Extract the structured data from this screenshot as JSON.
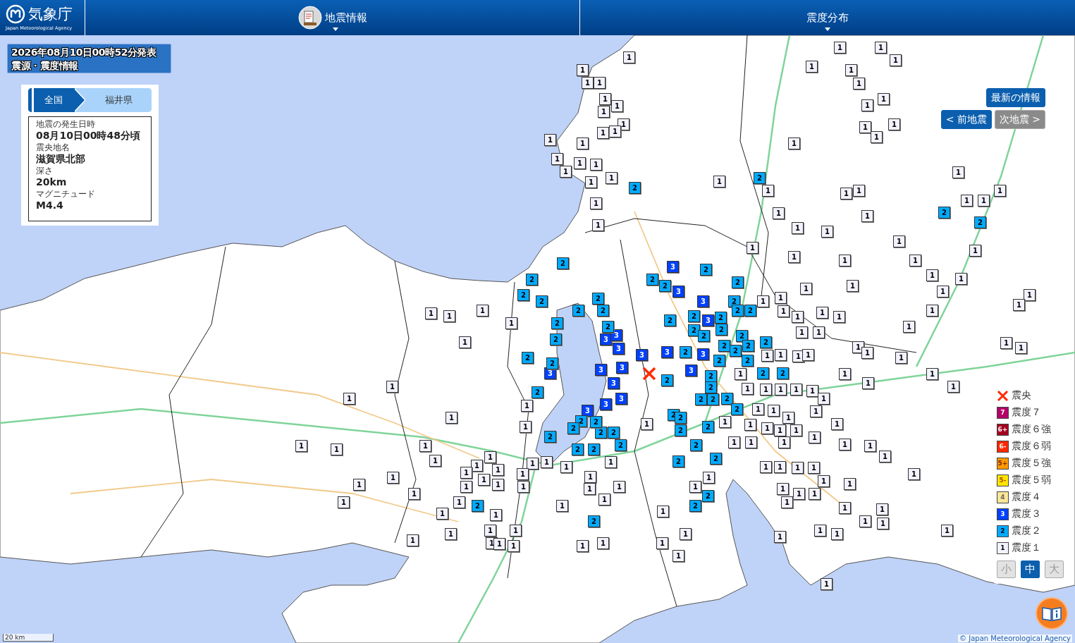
{
  "header": {
    "logo_title": "気象庁",
    "logo_subtitle": "Japan Meteorological Agency",
    "menus": [
      {
        "label": "地震情報",
        "has_icon": true
      },
      {
        "label": "震度分布",
        "has_icon": false
      }
    ]
  },
  "title_box": {
    "line_1": "2026年08月10日00時52分発表",
    "line_2": "震源・震度情報"
  },
  "info_panel": {
    "tabs": [
      {
        "label": "全国",
        "selected": true
      },
      {
        "label": "福井県",
        "selected": false
      }
    ],
    "fields": [
      {
        "label": "地震の発生日時",
        "value": "08月10日00時48分頃"
      },
      {
        "label": "震央地名",
        "value": "滋賀県北部"
      },
      {
        "label": "深さ",
        "value": "20km"
      },
      {
        "label": "マグニチュード",
        "value": "M4.4"
      }
    ]
  },
  "latest_button": "最新の情報",
  "nav_buttons": [
    {
      "label": "< 前地震",
      "disabled": false
    },
    {
      "label": "次地震 >",
      "disabled": true
    }
  ],
  "legend": {
    "items": [
      {
        "kind": "epicenter",
        "text": "震央"
      },
      {
        "kind": "s7",
        "badge": "7",
        "text": "震度７"
      },
      {
        "kind": "s6p",
        "badge": "6+",
        "text": "震度６強"
      },
      {
        "kind": "s6m",
        "badge": "6-",
        "text": "震度６弱"
      },
      {
        "kind": "s5p",
        "badge": "5+",
        "text": "震度５強"
      },
      {
        "kind": "s5m",
        "badge": "5-",
        "text": "震度５弱"
      },
      {
        "kind": "s4",
        "badge": "4",
        "text": "震度４"
      },
      {
        "kind": "s3",
        "badge": "3",
        "text": "震度３"
      },
      {
        "kind": "s2",
        "badge": "2",
        "text": "震度２"
      },
      {
        "kind": "s1",
        "badge": "1",
        "text": "震度１"
      }
    ],
    "sizes": [
      {
        "label": "小",
        "selected": false
      },
      {
        "label": "中",
        "selected": true
      },
      {
        "label": "大",
        "selected": false
      }
    ]
  },
  "scale_label": "20 km",
  "copyright": "© Japan Meteorological Agency",
  "markers": [
    {
      "kind": "s3",
      "label": "3"
    },
    {
      "kind": "s3",
      "label": "3"
    },
    {
      "kind": "s3",
      "label": "3"
    },
    {
      "kind": "s3",
      "label": "3"
    },
    {
      "kind": "s3",
      "label": "3"
    },
    {
      "kind": "s3",
      "label": "3"
    },
    {
      "kind": "s3",
      "label": "3"
    },
    {
      "kind": "s3",
      "label": "3"
    },
    {
      "kind": "s3",
      "label": "3"
    },
    {
      "kind": "s3",
      "label": "3"
    },
    {
      "kind": "s3",
      "label": "3"
    },
    {
      "kind": "s3",
      "label": "3"
    },
    {
      "kind": "s3",
      "label": "3"
    },
    {
      "kind": "s3",
      "label": "3"
    },
    {
      "kind": "s3",
      "label": "3"
    },
    {
      "kind": "s3",
      "label": "3"
    },
    {
      "kind": "s3",
      "label": "3"
    },
    {
      "kind": "s3",
      "label": "3"
    },
    {
      "kind": "s2",
      "label": "2"
    },
    {
      "kind": "s2",
      "label": "2"
    },
    {
      "kind": "s2",
      "label": "2"
    },
    {
      "kind": "s2",
      "label": "2"
    },
    {
      "kind": "s2",
      "label": "2"
    },
    {
      "kind": "s2",
      "label": "2"
    },
    {
      "kind": "s2",
      "label": "2"
    },
    {
      "kind": "s2",
      "label": "2"
    },
    {
      "kind": "s2",
      "label": "2"
    },
    {
      "kind": "s2",
      "label": "2"
    },
    {
      "kind": "s2",
      "label": "2"
    },
    {
      "kind": "s2",
      "label": "2"
    },
    {
      "kind": "s2",
      "label": "2"
    },
    {
      "kind": "s2",
      "label": "2"
    },
    {
      "kind": "s2",
      "label": "2"
    },
    {
      "kind": "s2",
      "label": "2"
    },
    {
      "kind": "s2",
      "label": "2"
    },
    {
      "kind": "s2",
      "label": "2"
    },
    {
      "kind": "s2",
      "label": "2"
    },
    {
      "kind": "s2",
      "label": "2"
    },
    {
      "kind": "s2",
      "label": "2"
    },
    {
      "kind": "s2",
      "label": "2"
    },
    {
      "kind": "s2",
      "label": "2"
    },
    {
      "kind": "s2",
      "label": "2"
    },
    {
      "kind": "s2",
      "label": "2"
    },
    {
      "kind": "s2",
      "label": "2"
    },
    {
      "kind": "s2",
      "label": "2"
    },
    {
      "kind": "s2",
      "label": "2"
    },
    {
      "kind": "s2",
      "label": "2"
    },
    {
      "kind": "s2",
      "label": "2"
    },
    {
      "kind": "s2",
      "label": "2"
    },
    {
      "kind": "s2",
      "label": "2"
    },
    {
      "kind": "s2",
      "label": "2"
    },
    {
      "kind": "s2",
      "label": "2"
    },
    {
      "kind": "s2",
      "label": "2"
    },
    {
      "kind": "s2",
      "label": "2"
    },
    {
      "kind": "s2",
      "label": "2"
    },
    {
      "kind": "s2",
      "label": "2"
    },
    {
      "kind": "s2",
      "label": "2"
    },
    {
      "kind": "s2",
      "label": "2"
    },
    {
      "kind": "s2",
      "label": "2"
    },
    {
      "kind": "s2",
      "label": "2"
    },
    {
      "kind": "s2",
      "label": "2"
    },
    {
      "kind": "s2",
      "label": "2"
    },
    {
      "kind": "s2",
      "label": "2"
    },
    {
      "kind": "s2",
      "label": "2"
    },
    {
      "kind": "s2",
      "label": "2"
    },
    {
      "kind": "s2",
      "label": "2"
    },
    {
      "kind": "s2",
      "label": "2"
    },
    {
      "kind": "s2",
      "label": "2"
    },
    {
      "kind": "s2",
      "label": "2"
    },
    {
      "kind": "s2",
      "label": "2"
    },
    {
      "kind": "s2",
      "label": "2"
    },
    {
      "kind": "s2",
      "label": "2"
    },
    {
      "kind": "s2",
      "label": "2"
    },
    {
      "kind": "s2",
      "label": "2"
    },
    {
      "kind": "s2",
      "label": "2"
    },
    {
      "kind": "s2",
      "label": "2"
    },
    {
      "kind": "s2",
      "label": "2"
    },
    {
      "kind": "s2",
      "label": "2"
    },
    {
      "kind": "s2",
      "label": "2"
    },
    {
      "kind": "s2",
      "label": "2"
    },
    {
      "kind": "s2",
      "label": "2"
    },
    {
      "kind": "s2",
      "label": "2"
    },
    {
      "kind": "s2",
      "label": "2"
    },
    {
      "kind": "s2",
      "label": "2"
    },
    {
      "kind": "s2",
      "label": "2"
    },
    {
      "kind": "s1",
      "label": "1"
    },
    {
      "kind": "s1",
      "label": "1"
    },
    {
      "kind": "s1",
      "label": "1"
    },
    {
      "kind": "s1",
      "label": "1"
    },
    {
      "kind": "s1",
      "label": "1"
    },
    {
      "kind": "s1",
      "label": "1"
    },
    {
      "kind": "s1",
      "label": "1"
    },
    {
      "kind": "s1",
      "label": "1"
    },
    {
      "kind": "s1",
      "label": "1"
    },
    {
      "kind": "s1",
      "label": "1"
    },
    {
      "kind": "s1",
      "label": "1"
    },
    {
      "kind": "s1",
      "label": "1"
    },
    {
      "kind": "s1",
      "label": "1"
    },
    {
      "kind": "s1",
      "label": "1"
    },
    {
      "kind": "s1",
      "label": "1"
    },
    {
      "kind": "s1",
      "label": "1"
    },
    {
      "kind": "s1",
      "label": "1"
    },
    {
      "kind": "s1",
      "label": "1"
    },
    {
      "kind": "s1",
      "label": "1"
    },
    {
      "kind": "s1",
      "label": "1"
    },
    {
      "kind": "s1",
      "label": "1"
    },
    {
      "kind": "s1",
      "label": "1"
    },
    {
      "kind": "s1",
      "label": "1"
    },
    {
      "kind": "s1",
      "label": "1"
    },
    {
      "kind": "s1",
      "label": "1"
    },
    {
      "kind": "s1",
      "label": "1"
    },
    {
      "kind": "s1",
      "label": "1"
    },
    {
      "kind": "s1",
      "label": "1"
    },
    {
      "kind": "s1",
      "label": "1"
    },
    {
      "kind": "s1",
      "label": "1"
    },
    {
      "kind": "s1",
      "label": "1"
    },
    {
      "kind": "s1",
      "label": "1"
    },
    {
      "kind": "s1",
      "label": "1"
    },
    {
      "kind": "s1",
      "label": "1"
    },
    {
      "kind": "s1",
      "label": "1"
    },
    {
      "kind": "s1",
      "label": "1"
    },
    {
      "kind": "s1",
      "label": "1"
    },
    {
      "kind": "s1",
      "label": "1"
    },
    {
      "kind": "s1",
      "label": "1"
    },
    {
      "kind": "s1",
      "label": "1"
    },
    {
      "kind": "s1",
      "label": "1"
    },
    {
      "kind": "s1",
      "label": "1"
    },
    {
      "kind": "s1",
      "label": "1"
    },
    {
      "kind": "s1",
      "label": "1"
    },
    {
      "kind": "s1",
      "label": "1"
    },
    {
      "kind": "s1",
      "label": "1"
    },
    {
      "kind": "s1",
      "label": "1"
    },
    {
      "kind": "s1",
      "label": "1"
    },
    {
      "kind": "s1",
      "label": "1"
    },
    {
      "kind": "s1",
      "label": "1"
    },
    {
      "kind": "s1",
      "label": "1"
    },
    {
      "kind": "s1",
      "label": "1"
    },
    {
      "kind": "s1",
      "label": "1"
    },
    {
      "kind": "s1",
      "label": "1"
    },
    {
      "kind": "s1",
      "label": "1"
    },
    {
      "kind": "s1",
      "label": "1"
    },
    {
      "kind": "s1",
      "label": "1"
    },
    {
      "kind": "s1",
      "label": "1"
    },
    {
      "kind": "s1",
      "label": "1"
    },
    {
      "kind": "s1",
      "label": "1"
    },
    {
      "kind": "s1",
      "label": "1"
    },
    {
      "kind": "s1",
      "label": "1"
    },
    {
      "kind": "s1",
      "label": "1"
    },
    {
      "kind": "s1",
      "label": "1"
    },
    {
      "kind": "s1",
      "label": "1"
    },
    {
      "kind": "s1",
      "label": "1"
    },
    {
      "kind": "s1",
      "label": "1"
    },
    {
      "kind": "s1",
      "label": "1"
    },
    {
      "kind": "s1",
      "label": "1"
    },
    {
      "kind": "s1",
      "label": "1"
    },
    {
      "kind": "s1",
      "label": "1"
    },
    {
      "kind": "s1",
      "label": "1"
    },
    {
      "kind": "s1",
      "label": "1"
    },
    {
      "kind": "s1",
      "label": "1"
    },
    {
      "kind": "s1",
      "label": "1"
    },
    {
      "kind": "s1",
      "label": "1"
    },
    {
      "kind": "s1",
      "label": "1"
    },
    {
      "kind": "s1",
      "label": "1"
    },
    {
      "kind": "s1",
      "label": "1"
    },
    {
      "kind": "s1",
      "label": "1"
    },
    {
      "kind": "s1",
      "label": "1"
    },
    {
      "kind": "s1",
      "label": "1"
    },
    {
      "kind": "s1",
      "label": "1"
    },
    {
      "kind": "s1",
      "label": "1"
    },
    {
      "kind": "s1",
      "label": "1"
    },
    {
      "kind": "s1",
      "label": "1"
    },
    {
      "kind": "s1",
      "label": "1"
    },
    {
      "kind": "s1",
      "label": "1"
    },
    {
      "kind": "s1",
      "label": "1"
    },
    {
      "kind": "s1",
      "label": "1"
    },
    {
      "kind": "s1",
      "label": "1"
    },
    {
      "kind": "s1",
      "label": "1"
    },
    {
      "kind": "s1",
      "label": "1"
    },
    {
      "kind": "s1",
      "label": "1"
    },
    {
      "kind": "s1",
      "label": "1"
    },
    {
      "kind": "s1",
      "label": "1"
    },
    {
      "kind": "s1",
      "label": "1"
    },
    {
      "kind": "s1",
      "label": "1"
    },
    {
      "kind": "s1",
      "label": "1"
    },
    {
      "kind": "s1",
      "label": "1"
    },
    {
      "kind": "s1",
      "label": "1"
    },
    {
      "kind": "s1",
      "label": "1"
    },
    {
      "kind": "s1",
      "label": "1"
    },
    {
      "kind": "s1",
      "label": "1"
    },
    {
      "kind": "s1",
      "label": "1"
    },
    {
      "kind": "s1",
      "label": "1"
    },
    {
      "kind": "s1",
      "label": "1"
    },
    {
      "kind": "s1",
      "label": "1"
    },
    {
      "kind": "s1",
      "label": "1"
    },
    {
      "kind": "s1",
      "label": "1"
    },
    {
      "kind": "s1",
      "label": "1"
    },
    {
      "kind": "s1",
      "label": "1"
    },
    {
      "kind": "s1",
      "label": "1"
    },
    {
      "kind": "s1",
      "label": "1"
    },
    {
      "kind": "s1",
      "label": "1"
    },
    {
      "kind": "s1",
      "label": "1"
    },
    {
      "kind": "s1",
      "label": "1"
    },
    {
      "kind": "s1",
      "label": "1"
    },
    {
      "kind": "s1",
      "label": "1"
    },
    {
      "kind": "s1",
      "label": "1"
    },
    {
      "kind": "s1",
      "label": "1"
    },
    {
      "kind": "s1",
      "label": "1"
    },
    {
      "kind": "s1",
      "label": "1"
    },
    {
      "kind": "s1",
      "label": "1"
    },
    {
      "kind": "s1",
      "label": "1"
    },
    {
      "kind": "s1",
      "label": "1"
    },
    {
      "kind": "s1",
      "label": "1"
    },
    {
      "kind": "s1",
      "label": "1"
    },
    {
      "kind": "s1",
      "label": "1"
    },
    {
      "kind": "s1",
      "label": "1"
    },
    {
      "kind": "s1",
      "label": "1"
    },
    {
      "kind": "s1",
      "label": "1"
    },
    {
      "kind": "s1",
      "label": "1"
    },
    {
      "kind": "s1",
      "label": "1"
    },
    {
      "kind": "s1",
      "label": "1"
    },
    {
      "kind": "s1",
      "label": "1"
    },
    {
      "kind": "s1",
      "label": "1"
    },
    {
      "kind": "s1",
      "label": "1"
    },
    {
      "kind": "s1",
      "label": "1"
    },
    {
      "kind": "s1",
      "label": "1"
    },
    {
      "kind": "s1",
      "label": "1"
    },
    {
      "kind": "s1",
      "label": "1"
    },
    {
      "kind": "s1",
      "label": "1"
    },
    {
      "kind": "s1",
      "label": "1"
    },
    {
      "kind": "s1",
      "label": "1"
    },
    {
      "kind": "s1",
      "label": "1"
    },
    {
      "kind": "s1",
      "label": "1"
    },
    {
      "kind": "s1",
      "label": "1"
    },
    {
      "kind": "s1",
      "label": "1"
    },
    {
      "kind": "s1",
      "label": "1"
    },
    {
      "kind": "s1",
      "label": "1"
    },
    {
      "kind": "s1",
      "label": "1"
    },
    {
      "kind": "s1",
      "label": "1"
    },
    {
      "kind": "s1",
      "label": "1"
    },
    {
      "kind": "s1",
      "label": "1"
    },
    {
      "kind": "s1",
      "label": "1"
    },
    {
      "kind": "s1",
      "label": "1"
    },
    {
      "kind": "s1",
      "label": "1"
    },
    {
      "kind": "s1",
      "label": "1"
    },
    {
      "kind": "s1",
      "label": "1"
    },
    {
      "kind": "s1",
      "label": "1"
    },
    {
      "kind": "s1",
      "label": "1"
    },
    {
      "kind": "s1",
      "label": "1"
    },
    {
      "kind": "s1",
      "label": "1"
    },
    {
      "kind": "s1",
      "label": "1"
    },
    {
      "kind": "s1",
      "label": "1"
    },
    {
      "kind": "s1",
      "label": "1"
    },
    {
      "kind": "s1",
      "label": "1"
    },
    {
      "kind": "s1",
      "label": "1"
    },
    {
      "kind": "s1",
      "label": "1"
    },
    {
      "kind": "s1",
      "label": "1"
    },
    {
      "kind": "s1",
      "label": "1"
    },
    {
      "kind": "s1",
      "label": "1"
    },
    {
      "kind": "s1",
      "label": "1"
    },
    {
      "kind": "s1",
      "label": "1"
    },
    {
      "kind": "s1",
      "label": "1"
    },
    {
      "kind": "s1",
      "label": "1"
    },
    {
      "kind": "s1",
      "label": "1"
    },
    {
      "kind": "s1",
      "label": "1"
    }
  ]
}
